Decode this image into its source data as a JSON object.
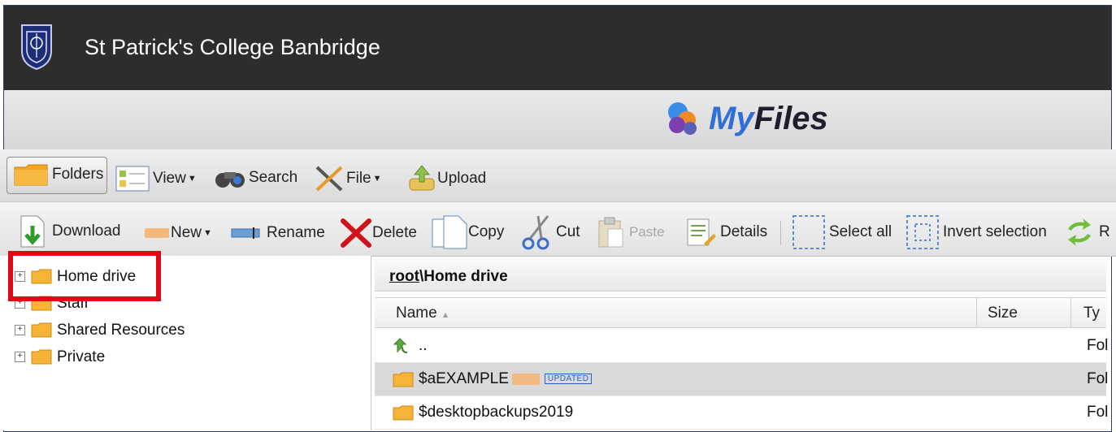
{
  "header": {
    "title": "St Patrick's College Banbridge"
  },
  "brand": {
    "my": "My",
    "files": "Files"
  },
  "toolbar1": {
    "folders": "Folders",
    "view": "View",
    "search": "Search",
    "file": "File",
    "upload": "Upload"
  },
  "toolbar2": {
    "download": "Download",
    "new": "New",
    "rename": "Rename",
    "delete": "Delete",
    "copy": "Copy",
    "cut": "Cut",
    "paste": "Paste",
    "details": "Details",
    "select_all": "Select all",
    "invert_selection": "Invert selection",
    "refresh": "R"
  },
  "tree": {
    "items": [
      {
        "label": "Home drive"
      },
      {
        "label": "Staff"
      },
      {
        "label": "Shared Resources"
      },
      {
        "label": "Private"
      }
    ]
  },
  "path": {
    "root": "root",
    "rest": "\\Home drive"
  },
  "table": {
    "headers": {
      "name": "Name",
      "size": "Size",
      "type": "Ty"
    },
    "rows": [
      {
        "name": "..",
        "type": "Fol"
      },
      {
        "name": "$aEXAMPLE",
        "badge": "UPDATED",
        "type": "Fol"
      },
      {
        "name": "$desktopbackups2019",
        "type": "Fol"
      }
    ]
  },
  "colors": {
    "topbar": "#2d2d2d",
    "highlight": "#e30613",
    "accent": "#2f6fd8"
  }
}
